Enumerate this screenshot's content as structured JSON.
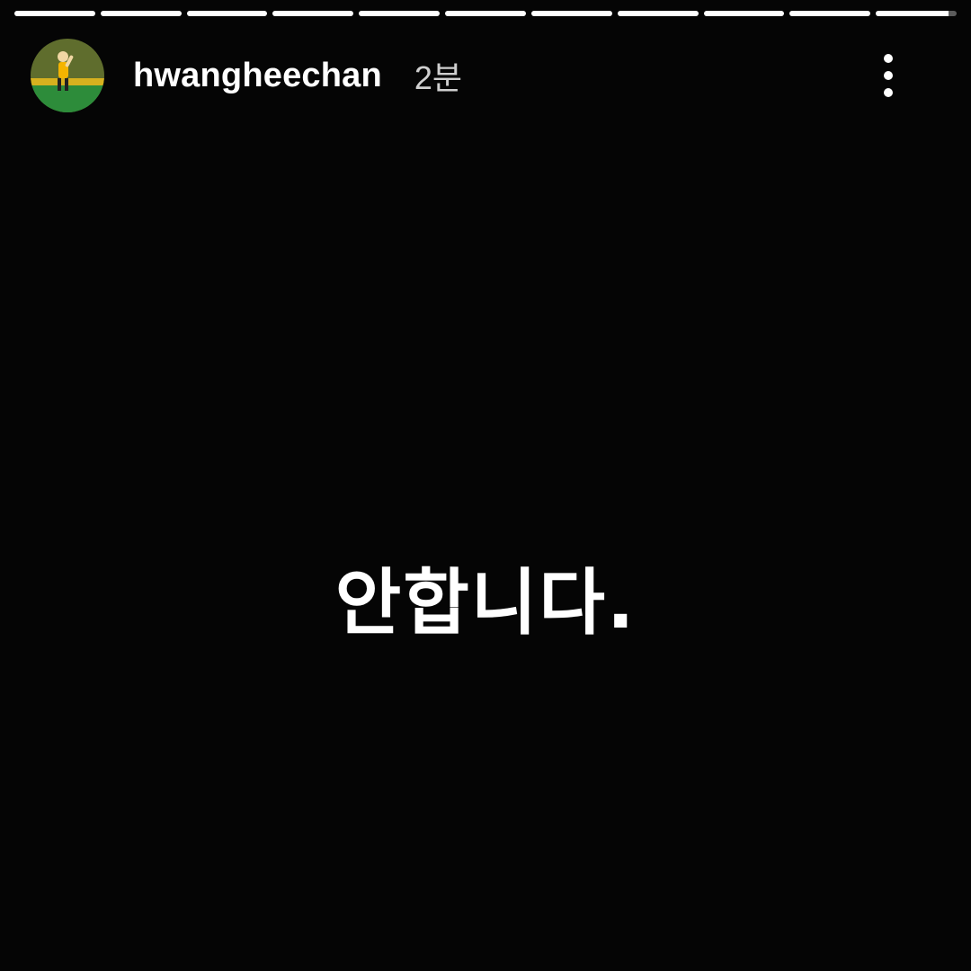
{
  "story": {
    "progress": [
      1,
      1,
      1,
      1,
      1,
      1,
      1,
      1,
      1,
      1,
      0.9
    ],
    "username": "hwangheechan",
    "time": "2분",
    "text": "안합니다.",
    "icons": {
      "avatar": "profile-photo-icon",
      "more": "more-vertical-icon"
    },
    "colors": {
      "background": "#050505",
      "text": "#ffffff",
      "time": "#cfcfcf"
    }
  }
}
